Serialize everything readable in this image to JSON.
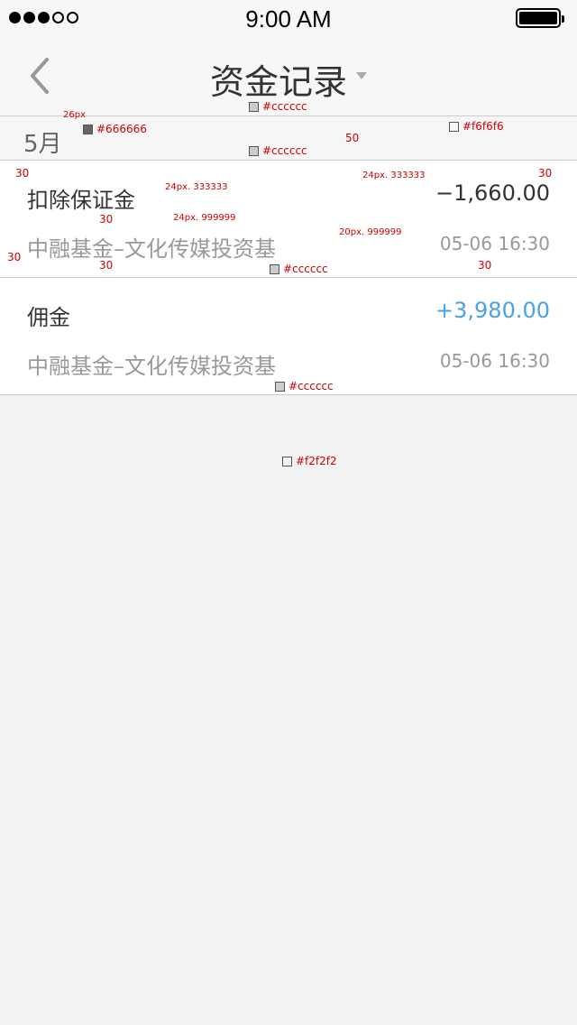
{
  "status_bar": {
    "time": "9:00 AM"
  },
  "nav": {
    "title": "资金记录"
  },
  "section": {
    "label": "5月"
  },
  "records": [
    {
      "title": "扣除保证金",
      "amount": "−1,660.00",
      "subtitle": "中融基金–文化传媒投资基",
      "datetime": "05-06 16:30"
    },
    {
      "title": "佣金",
      "amount": "+3,980.00",
      "subtitle": "中融基金–文化传媒投资基",
      "datetime": "05-06 16:30"
    }
  ],
  "annotations": {
    "a1": "26px",
    "a2": "#666666",
    "a3": "#cccccc",
    "a4": "50",
    "a5": "#f6f6f6",
    "a6": "#cccccc",
    "a7": "30",
    "a8": "24px. 333333",
    "a9": "24px. 333333",
    "a10": "30",
    "a11": "30",
    "a12": "24px. 999999",
    "a13": "20px. 999999",
    "a14": "30",
    "a15": "30",
    "a16": "#cccccc",
    "a17": "30",
    "a18": "#cccccc",
    "a19": "#f2f2f2"
  },
  "colors": {
    "accent_positive": "#47a2e9",
    "primary_text": "#333333",
    "secondary_text": "#999999",
    "divider": "#cccccc",
    "background": "#f2f2f2"
  }
}
